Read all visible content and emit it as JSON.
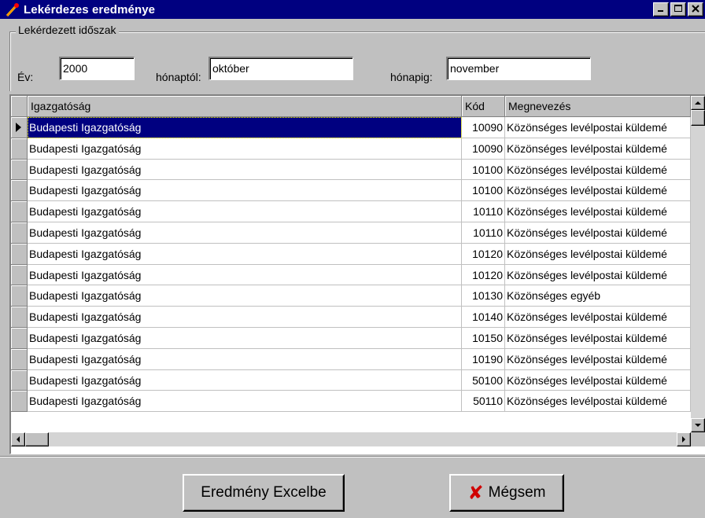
{
  "window": {
    "title": "Lekérdezes eredménye",
    "minimize": "_",
    "maximize": "□",
    "close": "×"
  },
  "period": {
    "legend": "Lekérdezett időszak",
    "year_label": "Év:",
    "year_value": "2000",
    "from_label": "hónaptól:",
    "from_value": "október",
    "to_label": "hónapig:",
    "to_value": "november"
  },
  "grid": {
    "columns": [
      "Igazgatóság",
      "Kód",
      "Megnevezés"
    ],
    "rows": [
      [
        "Budapesti Igazgatóság",
        "10090",
        "Közönséges levélpostai küldemé"
      ],
      [
        "Budapesti Igazgatóság",
        "10090",
        "Közönséges levélpostai küldemé"
      ],
      [
        "Budapesti Igazgatóság",
        "10100",
        "Közönséges levélpostai küldemé"
      ],
      [
        "Budapesti Igazgatóság",
        "10100",
        "Közönséges levélpostai küldemé"
      ],
      [
        "Budapesti Igazgatóság",
        "10110",
        "Közönséges levélpostai küldemé"
      ],
      [
        "Budapesti Igazgatóság",
        "10110",
        "Közönséges levélpostai küldemé"
      ],
      [
        "Budapesti Igazgatóság",
        "10120",
        "Közönséges levélpostai küldemé"
      ],
      [
        "Budapesti Igazgatóság",
        "10120",
        "Közönséges levélpostai küldemé"
      ],
      [
        "Budapesti Igazgatóság",
        "10130",
        "Közönséges egyéb"
      ],
      [
        "Budapesti Igazgatóság",
        "10140",
        "Közönséges levélpostai küldemé"
      ],
      [
        "Budapesti Igazgatóság",
        "10150",
        "Közönséges levélpostai küldemé"
      ],
      [
        "Budapesti Igazgatóság",
        "10190",
        "Közönséges levélpostai küldemé"
      ],
      [
        "Budapesti Igazgatóság",
        "50100",
        "Közönséges levélpostai küldemé"
      ],
      [
        "Budapesti Igazgatóság",
        "50110",
        "Közönséges levélpostai küldemé"
      ]
    ],
    "selected_row": 0
  },
  "buttons": {
    "export_label": "Eredmény Excelbe",
    "cancel_label": "Mégsem",
    "cancel_icon": "x-icon"
  },
  "colors": {
    "titlebar": "#000080",
    "selection": "#000080",
    "cancel_icon": "#d00000"
  }
}
